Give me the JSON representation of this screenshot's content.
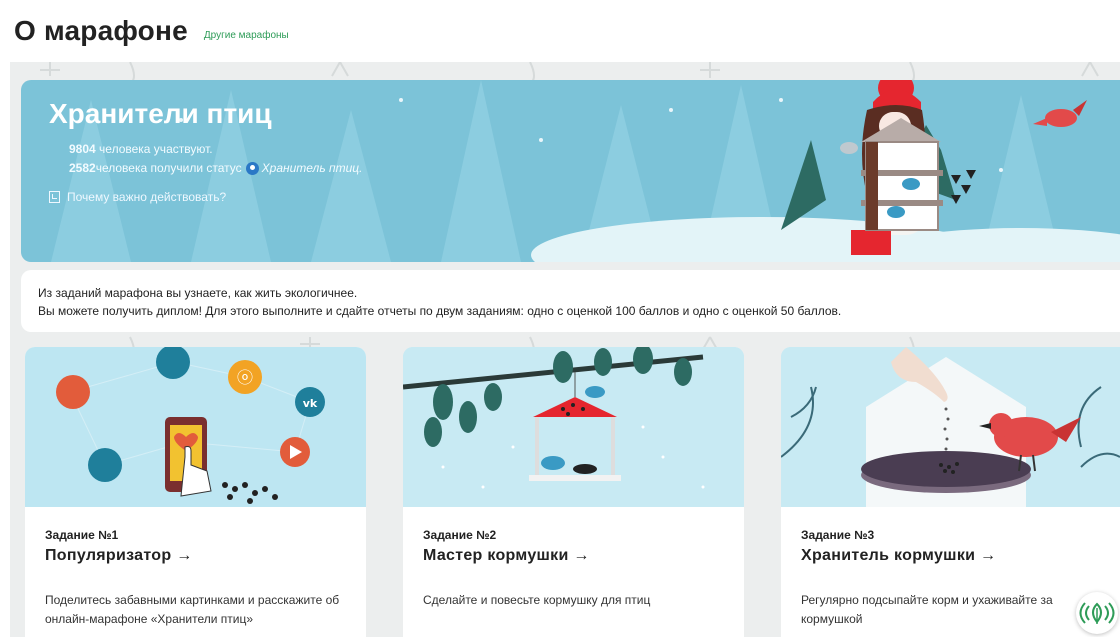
{
  "header": {
    "title": "О марафоне",
    "other_link": "Другие марафоны"
  },
  "hero": {
    "title": "Хранители птиц",
    "participants_count": "9804",
    "participants_text": " человека участвуют.",
    "status_count": "2582",
    "status_text": " человека получили статус",
    "status_name": "Хранитель птиц.",
    "why_link": "Почему важно действовать?"
  },
  "info": {
    "line1": "Из заданий марафона вы узнаете, как жить экологичнее.",
    "line2": "Вы можете получить диплом! Для этого выполните и сдайте отчеты по двум заданиям: одно с оценкой 100 баллов и одно с оценкой 50 баллов."
  },
  "cards": [
    {
      "number": "Задание №1",
      "name": "Популяризатор →",
      "description": "Поделитесь забавными картинками и расскажите об онлайн-марафоне «Хранители птиц»"
    },
    {
      "number": "Задание №2",
      "name": "Мастер кормушки →",
      "description": "Сделайте и повесьте кормушку для птиц"
    },
    {
      "number": "Задание №3",
      "name": "Хранитель кормушки →",
      "description": "Регулярно подсыпайте корм и ухаживайте за кормушкой"
    }
  ],
  "colors": {
    "accent_green": "#2e9c58",
    "hero_blue": "#7cc3d8",
    "card_sky": "#bde6f2",
    "hat_red": "#e5262f"
  },
  "icons": {
    "badge": "bird-keeper-badge-icon",
    "why": "document-icon",
    "widget": "leaf-wifi-icon"
  }
}
